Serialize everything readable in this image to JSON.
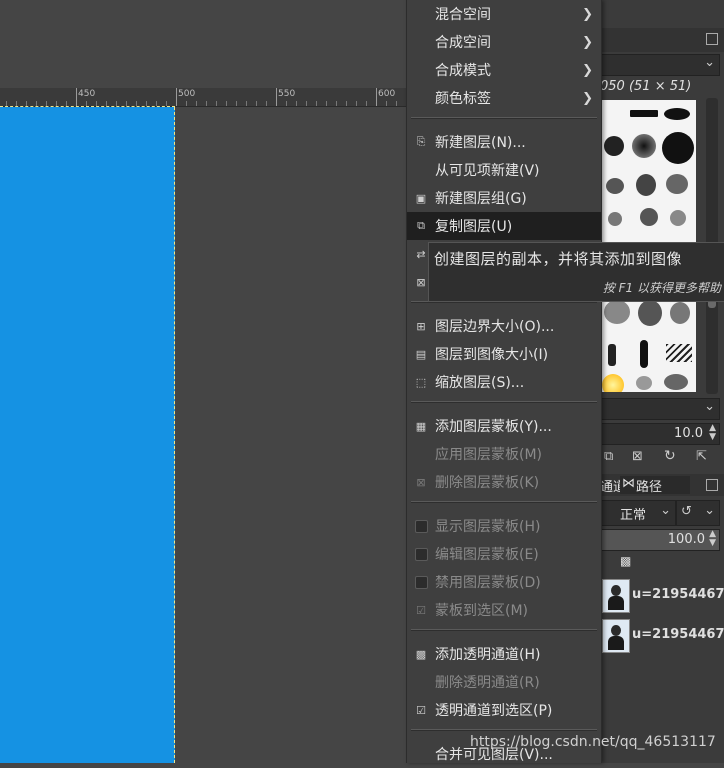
{
  "ruler": {
    "labels": [
      "450",
      "500",
      "550",
      "600"
    ]
  },
  "menu": {
    "items": [
      {
        "label": "混合空间",
        "submenu": true
      },
      {
        "label": "合成空间",
        "submenu": true
      },
      {
        "label": "合成模式",
        "submenu": true
      },
      {
        "label": "颜色标签",
        "submenu": true
      },
      {
        "label": "新建图层(N)..."
      },
      {
        "label": "从可见项新建(V)"
      },
      {
        "label": "新建图层组(G)"
      },
      {
        "label": "复制图层(U)",
        "selected": true
      },
      {
        "label": "图层边界大小(O)..."
      },
      {
        "label": "图层到图像大小(I)"
      },
      {
        "label": "缩放图层(S)..."
      },
      {
        "label": "添加图层蒙板(Y)..."
      },
      {
        "label": "应用图层蒙板(M)",
        "disabled": true
      },
      {
        "label": "删除图层蒙板(K)",
        "disabled": true
      },
      {
        "label": "显示图层蒙板(H)",
        "disabled": true
      },
      {
        "label": "编辑图层蒙板(E)",
        "disabled": true
      },
      {
        "label": "禁用图层蒙板(D)",
        "disabled": true
      },
      {
        "label": "蒙板到选区(M)",
        "disabled": true
      },
      {
        "label": "添加透明通道(H)"
      },
      {
        "label": "删除透明通道(R)",
        "disabled": true
      },
      {
        "label": "透明通道到选区(P)"
      },
      {
        "label": "合并可见图层(V)..."
      }
    ]
  },
  "tooltip": {
    "text": "创建图层的副本，并将其添加到图像",
    "hint": "按 F1 以获得更多帮助"
  },
  "right_panel": {
    "brush_size": "050 (51 × 51)",
    "spacing_value": "10.0",
    "tabs": [
      "通道",
      "路径"
    ],
    "mode": "正常",
    "opacity": "100.0",
    "layers": [
      {
        "name": "u=21954467"
      },
      {
        "name": "u=21954467"
      }
    ]
  },
  "watermark": "https://blog.csdn.net/qq_46513117",
  "colors": {
    "image_blue": "#1592e3",
    "menu_bg": "#3f3f3f",
    "selected_bg": "#1f1f1f"
  }
}
